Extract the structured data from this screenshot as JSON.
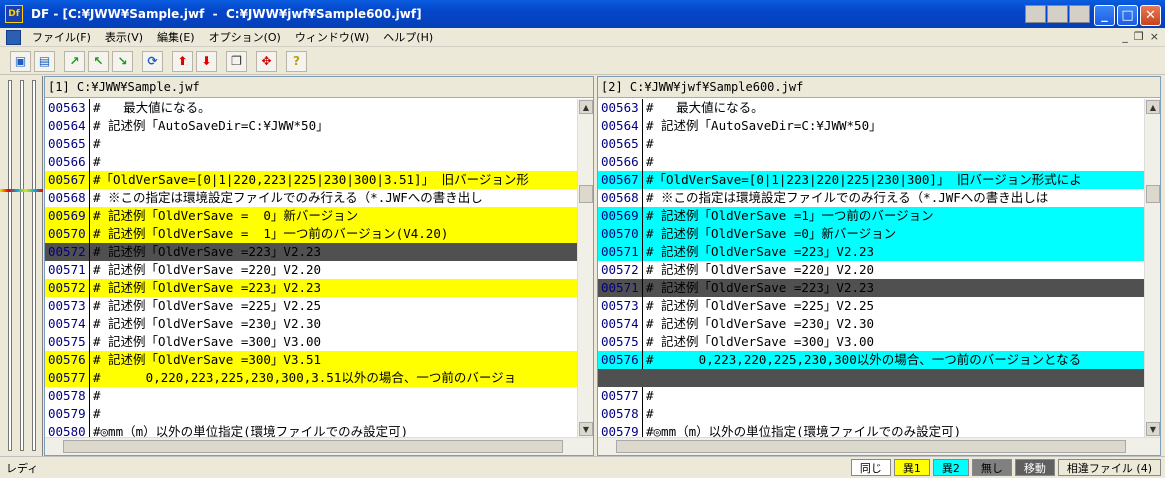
{
  "window": {
    "title": "DF - [C:¥JWW¥Sample.jwf  -  C:¥JWW¥jwf¥Sample600.jwf]",
    "app_icon": "Df"
  },
  "menu": [
    "ファイル(F)",
    "表示(V)",
    "編集(E)",
    "オプション(O)",
    "ウィンドウ(W)",
    "ヘルプ(H)"
  ],
  "toolbar_icons": [
    "open-pair-icon",
    "open-icon",
    "next-diff-icon",
    "prev-diff-icon",
    "sync-icon",
    "refresh-icon",
    "move-up-icon",
    "move-down-icon",
    "copy-icon",
    "split-icon",
    "help-icon"
  ],
  "left": {
    "header": "[1] C:¥JWW¥Sample.jwf",
    "lines": [
      {
        "num": "00563",
        "text": "#   最大値になる。",
        "style": "none"
      },
      {
        "num": "00564",
        "text": "# 記述例「AutoSaveDir=C:¥JWW*50」",
        "style": "none"
      },
      {
        "num": "00565",
        "text": "#",
        "style": "none"
      },
      {
        "num": "00566",
        "text": "#",
        "style": "none"
      },
      {
        "num": "00567",
        "text": "#「OldVerSave=[0|1|220,223|225|230|300|3.51]」 旧バージョン形",
        "style": "yellow"
      },
      {
        "num": "00568",
        "text": "# ※この指定は環境設定ファイルでのみ行える（*.JWFへの書き出し",
        "style": "none"
      },
      {
        "num": "00569",
        "text": "# 記述例「OldVerSave =  0」新バージョン",
        "style": "yellow"
      },
      {
        "num": "00570",
        "text": "# 記述例「OldVerSave =  1」一つ前のバージョン(V4.20)",
        "style": "yellow"
      },
      {
        "num": "00572",
        "text": "# 記述例「OldVerSave =223」V2.23",
        "style": "dark"
      },
      {
        "num": "00571",
        "text": "# 記述例「OldVerSave =220」V2.20",
        "style": "none"
      },
      {
        "num": "00572",
        "text": "# 記述例「OldVerSave =223」V2.23",
        "style": "yellow"
      },
      {
        "num": "00573",
        "text": "# 記述例「OldVerSave =225」V2.25",
        "style": "none"
      },
      {
        "num": "00574",
        "text": "# 記述例「OldVerSave =230」V2.30",
        "style": "none"
      },
      {
        "num": "00575",
        "text": "# 記述例「OldVerSave =300」V3.00",
        "style": "none"
      },
      {
        "num": "00576",
        "text": "# 記述例「OldVerSave =300」V3.51",
        "style": "yellow"
      },
      {
        "num": "00577",
        "text": "#      0,220,223,225,230,300,3.51以外の場合、一つ前のバージョ",
        "style": "yellow"
      },
      {
        "num": "00578",
        "text": "#",
        "style": "none"
      },
      {
        "num": "00579",
        "text": "#",
        "style": "none"
      },
      {
        "num": "00580",
        "text": "#◎mm（m）以外の単位指定(環境ファイルでのみ設定可)",
        "style": "none"
      }
    ]
  },
  "right": {
    "header": "[2] C:¥JWW¥jwf¥Sample600.jwf",
    "lines": [
      {
        "num": "00563",
        "text": "#   最大値になる。",
        "style": "none"
      },
      {
        "num": "00564",
        "text": "# 記述例「AutoSaveDir=C:¥JWW*50」",
        "style": "none"
      },
      {
        "num": "00565",
        "text": "#",
        "style": "none"
      },
      {
        "num": "00566",
        "text": "#",
        "style": "none"
      },
      {
        "num": "00567",
        "text": "#「OldVerSave=[0|1|223|220|225|230|300]」 旧バージョン形式によ",
        "style": "cyan"
      },
      {
        "num": "00568",
        "text": "# ※この指定は環境設定ファイルでのみ行える（*.JWFへの書き出しは",
        "style": "none"
      },
      {
        "num": "00569",
        "text": "# 記述例「OldVerSave =1」一つ前のバージョン",
        "style": "cyan"
      },
      {
        "num": "00570",
        "text": "# 記述例「OldVerSave =0」新バージョン",
        "style": "cyan"
      },
      {
        "num": "00571",
        "text": "# 記述例「OldVerSave =223」V2.23",
        "style": "cyan"
      },
      {
        "num": "00572",
        "text": "# 記述例「OldVerSave =220」V2.20",
        "style": "none"
      },
      {
        "num": "00571",
        "text": "# 記述例「OldVerSave =223」V2.23",
        "style": "dark"
      },
      {
        "num": "00573",
        "text": "# 記述例「OldVerSave =225」V2.25",
        "style": "none"
      },
      {
        "num": "00574",
        "text": "# 記述例「OldVerSave =230」V2.30",
        "style": "none"
      },
      {
        "num": "00575",
        "text": "# 記述例「OldVerSave =300」V3.00",
        "style": "none"
      },
      {
        "num": "00576",
        "text": "#      0,223,220,225,230,300以外の場合、一つ前のバージョンとなる",
        "style": "cyan"
      },
      {
        "num": "",
        "text": "",
        "style": "dark"
      },
      {
        "num": "00577",
        "text": "#",
        "style": "none"
      },
      {
        "num": "00578",
        "text": "#",
        "style": "none"
      },
      {
        "num": "00579",
        "text": "#◎mm（m）以外の単位指定(環境ファイルでのみ設定可)",
        "style": "none"
      }
    ]
  },
  "status": {
    "text": "レディ",
    "legend": [
      {
        "label": "同じ",
        "bg": "#ffffff",
        "fg": "#000000"
      },
      {
        "label": "異1",
        "bg": "#ffff00",
        "fg": "#000000"
      },
      {
        "label": "異2",
        "bg": "#00ffff",
        "fg": "#000000"
      },
      {
        "label": "無し",
        "bg": "#808080",
        "fg": "#000000"
      },
      {
        "label": "移動",
        "bg": "#606060",
        "fg": "#ffffff"
      },
      {
        "label": "相違ファイル (4)",
        "bg": "#ece9d8",
        "fg": "#000000"
      }
    ]
  }
}
